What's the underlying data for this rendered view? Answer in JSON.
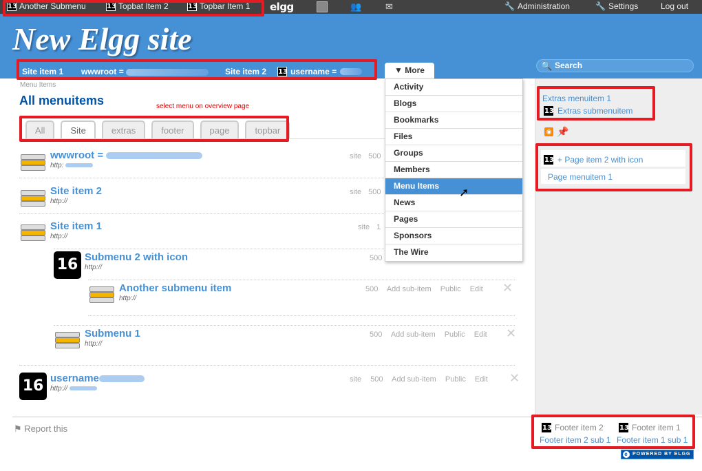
{
  "topbar": {
    "items": [
      "Another Submenu",
      "Topbat Item 2",
      "Topbar Item 1"
    ],
    "logo": "elgg",
    "administration": "Administration",
    "settings": "Settings",
    "logout": "Log out"
  },
  "header": {
    "site_title": "New Elgg site",
    "site_menu": {
      "item1": "Site item 1",
      "wwwroot": "wwwroot =",
      "item2": "Site item 2",
      "username": "username ="
    },
    "more": "▼ More",
    "search_placeholder": "Search"
  },
  "dropdown": {
    "items": [
      "Activity",
      "Blogs",
      "Bookmarks",
      "Files",
      "Groups",
      "Members",
      "Menu Items",
      "News",
      "Pages",
      "Sponsors",
      "The Wire"
    ],
    "active": "Menu Items"
  },
  "main": {
    "breadcrumb": "Menu Items",
    "title": "All menuitems",
    "hint": "select menu on overview page",
    "tabs": [
      "All",
      "Site",
      "extras",
      "footer",
      "page",
      "topbar"
    ],
    "selected_tab": "Site"
  },
  "rows": [
    {
      "title": "wwwroot =",
      "url": "http:",
      "context": "site",
      "priority": "500"
    },
    {
      "title": "Site item 2",
      "url": "http://",
      "context": "site",
      "priority": "500"
    },
    {
      "title": "Site item 1",
      "url": "http://",
      "context": "site",
      "priority": "1"
    },
    {
      "title": "Submenu 2 with icon",
      "url": "http://",
      "priority": "500"
    },
    {
      "title": "Another submenu item",
      "url": "http://",
      "priority": "500",
      "add": "Add sub-item",
      "access": "Public",
      "edit": "Edit"
    },
    {
      "title": "Submenu 1",
      "url": "http://",
      "priority": "500",
      "add": "Add sub-item",
      "access": "Public",
      "edit": "Edit"
    },
    {
      "title": "username",
      "url": "http://",
      "context": "site",
      "priority": "500",
      "add": "Add sub-item",
      "access": "Public",
      "edit": "Edit"
    }
  ],
  "sidebar": {
    "extras_item": "Extras menuitem 1",
    "extras_sub": "Extras submenuitem",
    "page_item2": "+ Page item 2 with icon",
    "page_item1": "Page menuitem 1"
  },
  "footer": {
    "report": "Report this",
    "item2": "Footer item 2",
    "item1": "Footer item 1",
    "item2_sub": "Footer item 2 sub 1",
    "item1_sub": "Footer item 1 sub 1",
    "powered": "POWERED BY ELGG"
  },
  "colors": {
    "header_blue": "#4690D6",
    "topbar": "#424242",
    "annotation_red": "#e51b24",
    "link": "#4690D6"
  }
}
